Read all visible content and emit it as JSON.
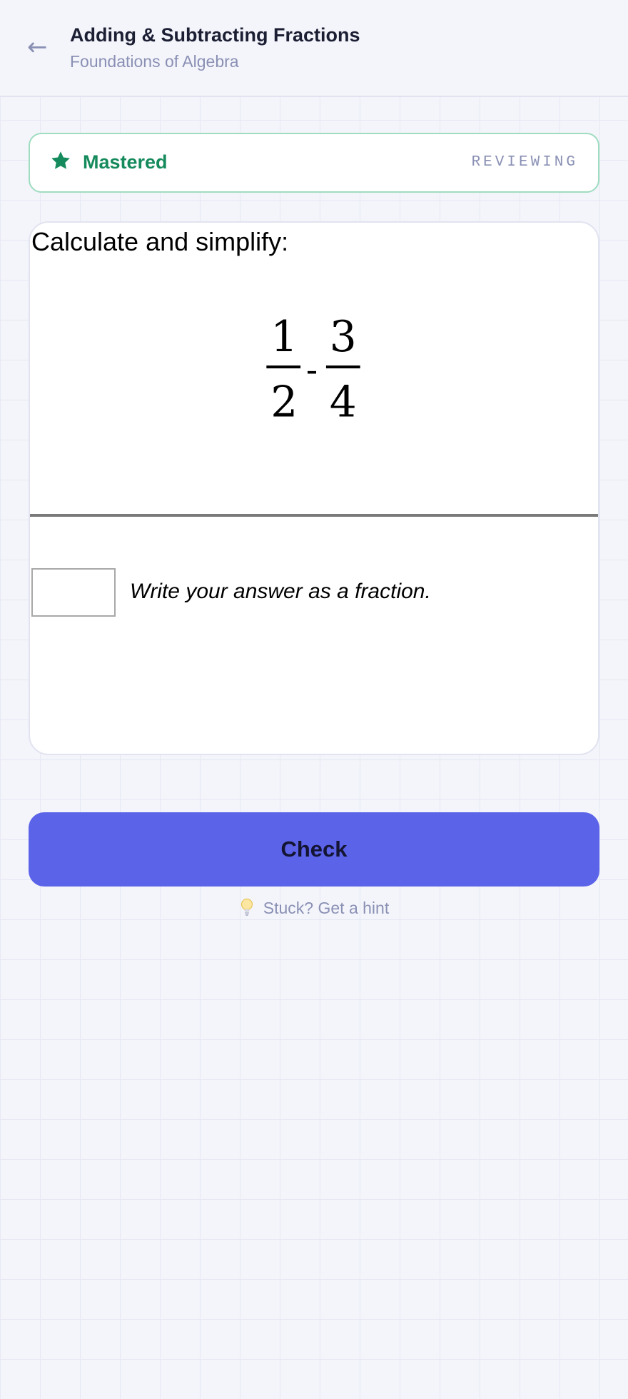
{
  "header": {
    "back_icon": "arrow-left-icon",
    "title": "Adding & Subtracting Fractions",
    "subtitle": "Foundations of Algebra"
  },
  "mastery": {
    "icon": "star-icon",
    "status": "Mastered",
    "mode": "REVIEWING",
    "color": "#158a5c"
  },
  "question": {
    "prompt": "Calculate and simplify:",
    "fraction_a": {
      "numerator": "1",
      "denominator": "2"
    },
    "operator": "-",
    "fraction_b": {
      "numerator": "3",
      "denominator": "4"
    },
    "answer_value": "",
    "instruction": "Write your answer as a fraction."
  },
  "actions": {
    "check_label": "Check",
    "check_color": "#5b63e8",
    "hint_icon": "lightbulb-icon",
    "hint_label": "Stuck? Get a hint"
  }
}
